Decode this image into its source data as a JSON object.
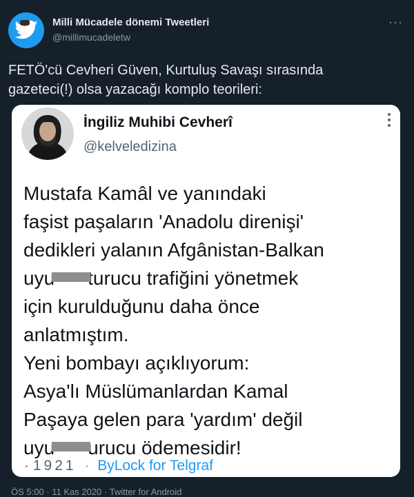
{
  "header": {
    "name": "Milli Mücadele dönemi Tweetleri",
    "handle": "@millimucadeletw",
    "more": "···"
  },
  "tweet": {
    "line1": "FETÖ'cü Cevheri Güven, Kurtuluş Savaşı sırasında",
    "line2": "gazeteci(!) olsa yazacağı komplo teorileri:"
  },
  "quoted": {
    "name": "İngiliz Muhibi Cevherî",
    "handle": "@kelveledizina",
    "lines": [
      "Mustafa Kamâl ve yanındaki",
      "faşist paşaların 'Anadolu direnişi'",
      "dedikleri yalanın Afgânistan-Balkan",
      "uyu",
      "turucu trafiğini yönetmek",
      "için kurulduğunu daha önce",
      "anlatmıştım.",
      "Yeni bombayı açıklıyorum:",
      "Asya'lı Müslümanlardan Kamal",
      "Paşaya gelen para 'yardım' değil",
      "uyu",
      "urucu ödemesidir!"
    ],
    "footer": {
      "dot": "·",
      "year": "1921",
      "source": "ByLock for Telgraf"
    }
  },
  "bottom_meta": "ÖS 5:00 · 11 Kas 2020 · Twitter for Android",
  "colors": {
    "background": "#15202b",
    "card": "#ffffff",
    "accent": "#1d9bf0"
  },
  "icons": {
    "avatar": "twitter-bird-icon",
    "card_more": "vertical-dots-icon"
  }
}
